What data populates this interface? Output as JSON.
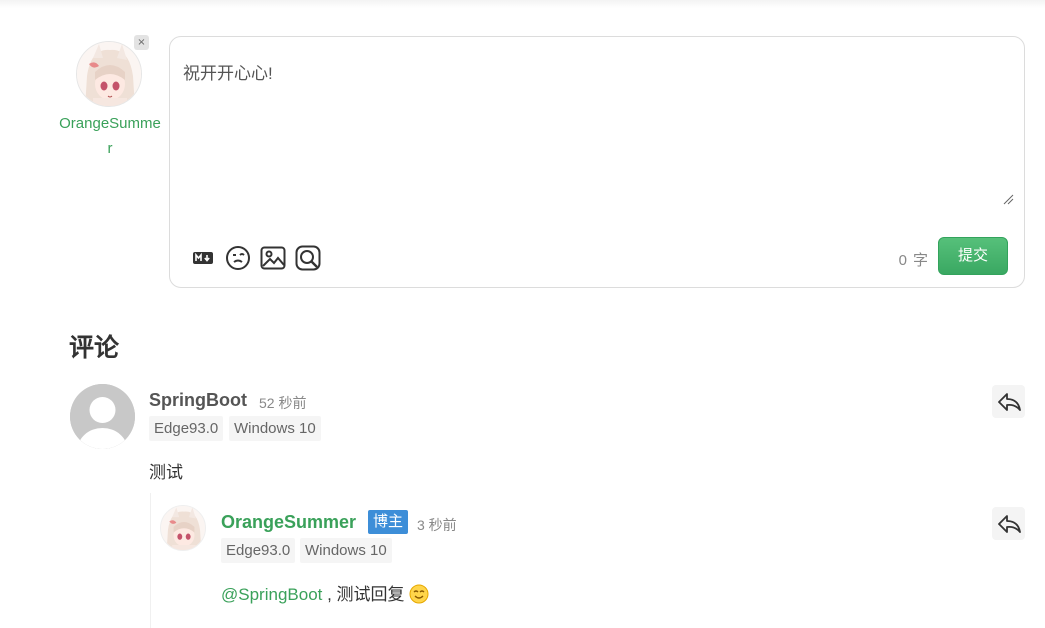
{
  "composer": {
    "user_name": "OrangeSummer",
    "text": "祝开开心心!",
    "char_count": "0",
    "char_unit": "字",
    "submit_label": "提交",
    "close_glyph": "×",
    "tools": [
      "markdown-icon",
      "emoji-icon",
      "image-icon",
      "preview-icon"
    ]
  },
  "comments": {
    "title": "评论",
    "items": [
      {
        "author": "SpringBoot",
        "time": "52 秒前",
        "browser": "Edge93.0",
        "os": "Windows 10",
        "body": "测试",
        "replies": [
          {
            "author": "OrangeSummer",
            "badge": "博主",
            "time": "3 秒前",
            "browser": "Edge93.0",
            "os": "Windows 10",
            "mention": "@SpringBoot",
            "body": " , 测试回复 "
          }
        ]
      }
    ]
  },
  "colors": {
    "accent_green": "#3aa15a",
    "submit_green": "#3aa862",
    "owner_badge": "#3d8ed8"
  }
}
